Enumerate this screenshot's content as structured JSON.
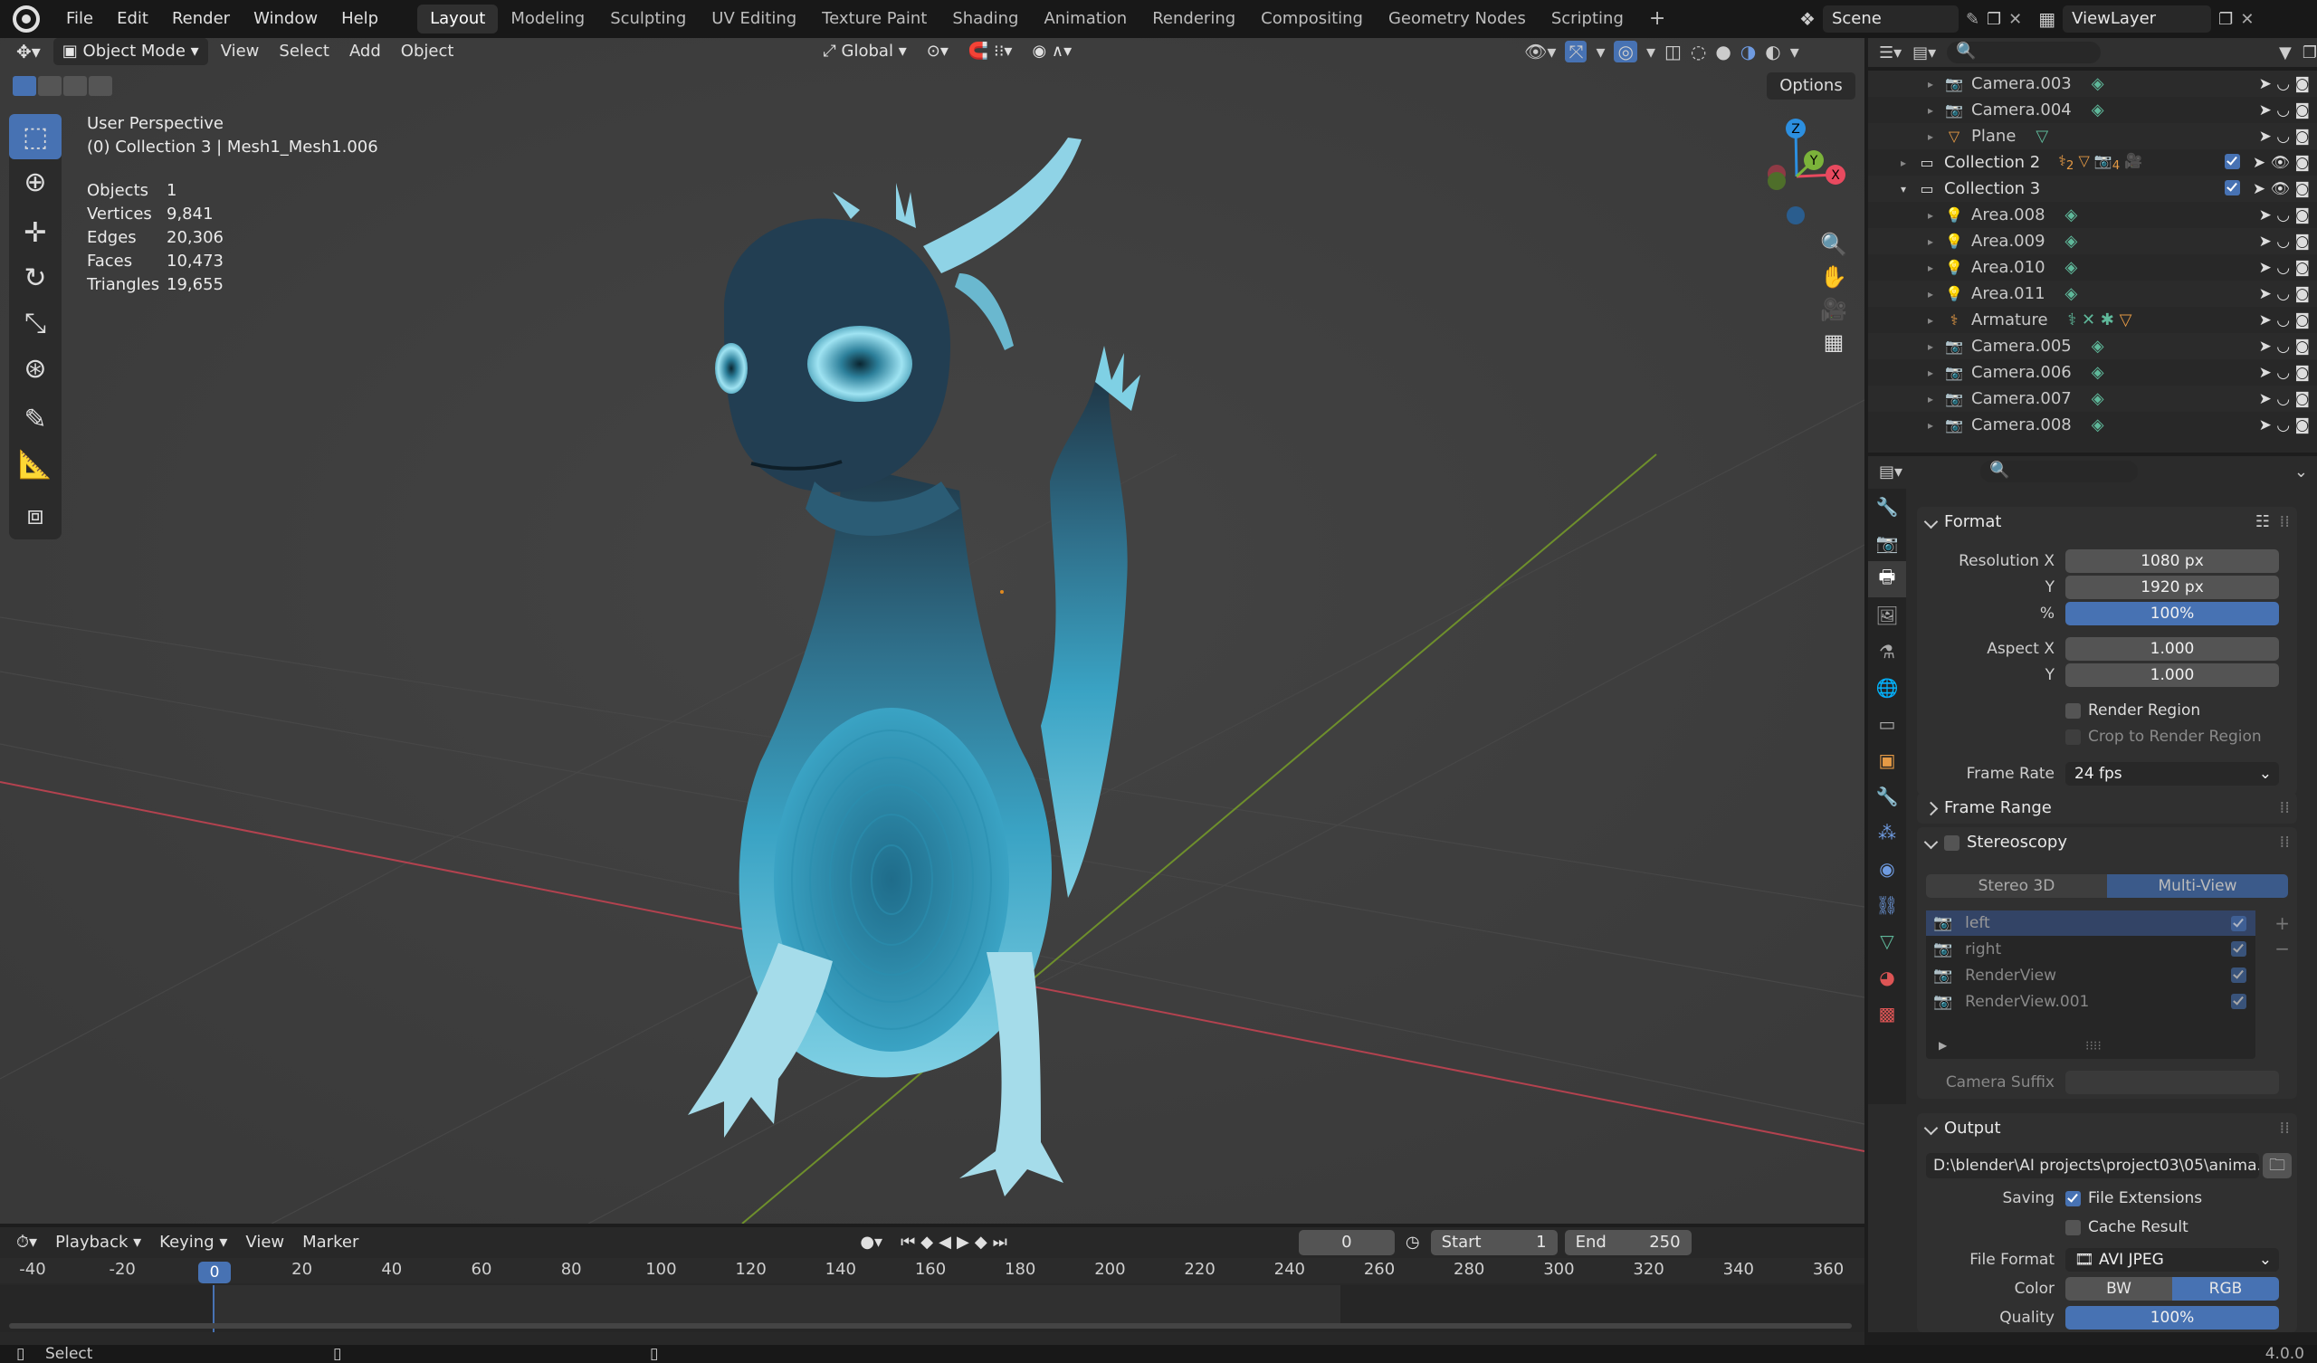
{
  "menubar": {
    "items": [
      "File",
      "Edit",
      "Render",
      "Window",
      "Help"
    ],
    "workspaces": [
      "Layout",
      "Modeling",
      "Sculpting",
      "UV Editing",
      "Texture Paint",
      "Shading",
      "Animation",
      "Rendering",
      "Compositing",
      "Geometry Nodes",
      "Scripting"
    ],
    "active_workspace": "Layout",
    "add_tab": "+",
    "scene": "Scene",
    "view_layer": "ViewLayer"
  },
  "viewport_header": {
    "mode": "Object Mode",
    "menus": [
      "View",
      "Select",
      "Add",
      "Object"
    ],
    "transform_orientation": "Global",
    "options": "Options"
  },
  "viewport_info": {
    "view_name": "User Perspective",
    "collection_line": "(0) Collection 3 | Mesh1_Mesh1.006",
    "stats": [
      {
        "label": "Objects",
        "value": "1"
      },
      {
        "label": "Vertices",
        "value": "9,841"
      },
      {
        "label": "Edges",
        "value": "20,306"
      },
      {
        "label": "Faces",
        "value": "10,473"
      },
      {
        "label": "Triangles",
        "value": "19,655"
      }
    ]
  },
  "gizmo": {
    "z": "Z",
    "y": "Y",
    "x": "X"
  },
  "outliner": {
    "rows": [
      {
        "name": "Camera.003",
        "icon": "camera-icon",
        "indent": 2
      },
      {
        "name": "Camera.004",
        "icon": "camera-icon",
        "indent": 2
      },
      {
        "name": "Plane",
        "icon": "mesh-icon",
        "indent": 2
      },
      {
        "name": "Collection 2",
        "icon": "collection-icon",
        "indent": 1
      },
      {
        "name": "Collection 3",
        "icon": "collection-icon",
        "indent": 1
      },
      {
        "name": "Area.008",
        "icon": "light-icon",
        "indent": 2
      },
      {
        "name": "Area.009",
        "icon": "light-icon",
        "indent": 2
      },
      {
        "name": "Area.010",
        "icon": "light-icon",
        "indent": 2
      },
      {
        "name": "Area.011",
        "icon": "light-icon",
        "indent": 2
      },
      {
        "name": "Armature",
        "icon": "armature-icon",
        "indent": 2
      },
      {
        "name": "Camera.005",
        "icon": "camera-icon",
        "indent": 2
      },
      {
        "name": "Camera.006",
        "icon": "camera-icon",
        "indent": 2
      },
      {
        "name": "Camera.007",
        "icon": "camera-icon",
        "indent": 2
      },
      {
        "name": "Camera.008",
        "icon": "camera-icon",
        "indent": 2
      }
    ],
    "collection2_counts": [
      "2",
      "4"
    ]
  },
  "properties": {
    "format": {
      "title": "Format",
      "resolution_x_label": "Resolution X",
      "resolution_x": "1080 px",
      "y_label": "Y",
      "resolution_y": "1920 px",
      "pct_label": "%",
      "resolution_pct": "100%",
      "aspect_x_label": "Aspect X",
      "aspect_x": "1.000",
      "aspect_y_label": "Y",
      "aspect_y": "1.000",
      "render_region": "Render Region",
      "crop_region": "Crop to Render Region",
      "frame_rate_label": "Frame Rate",
      "frame_rate": "24 fps"
    },
    "frame_range": {
      "title": "Frame Range"
    },
    "stereoscopy": {
      "title": "Stereoscopy",
      "mode_a": "Stereo 3D",
      "mode_b": "Multi-View",
      "views": [
        "left",
        "right",
        "RenderView",
        "RenderView.001"
      ],
      "camera_suffix_label": "Camera Suffix"
    },
    "output": {
      "title": "Output",
      "path": "D:\\blender\\AI projects\\project03\\05\\anima...",
      "saving_label": "Saving",
      "file_extensions": "File Extensions",
      "cache_result": "Cache Result",
      "file_format_label": "File Format",
      "file_format": "AVI JPEG",
      "color_label": "Color",
      "color_bw": "BW",
      "color_rgb": "RGB",
      "quality_label": "Quality",
      "quality": "100%"
    }
  },
  "timeline": {
    "menus": [
      "Playback",
      "Keying",
      "View",
      "Marker"
    ],
    "current_frame": "0",
    "start_label": "Start",
    "start": "1",
    "end_label": "End",
    "end": "250",
    "ticks": [
      "-40",
      "-20",
      "0",
      "20",
      "40",
      "60",
      "80",
      "100",
      "120",
      "140",
      "160",
      "180",
      "200",
      "220",
      "240",
      "260",
      "280",
      "300",
      "320",
      "340",
      "360"
    ]
  },
  "statusbar": {
    "hint": "Select",
    "version": "4.0.0"
  },
  "colors": {
    "accent": "#4772b3",
    "creature": "#3aa3c4",
    "x_axis": "#e84a5f",
    "y_axis": "#7bb33a",
    "z_axis": "#2c8fe0"
  }
}
